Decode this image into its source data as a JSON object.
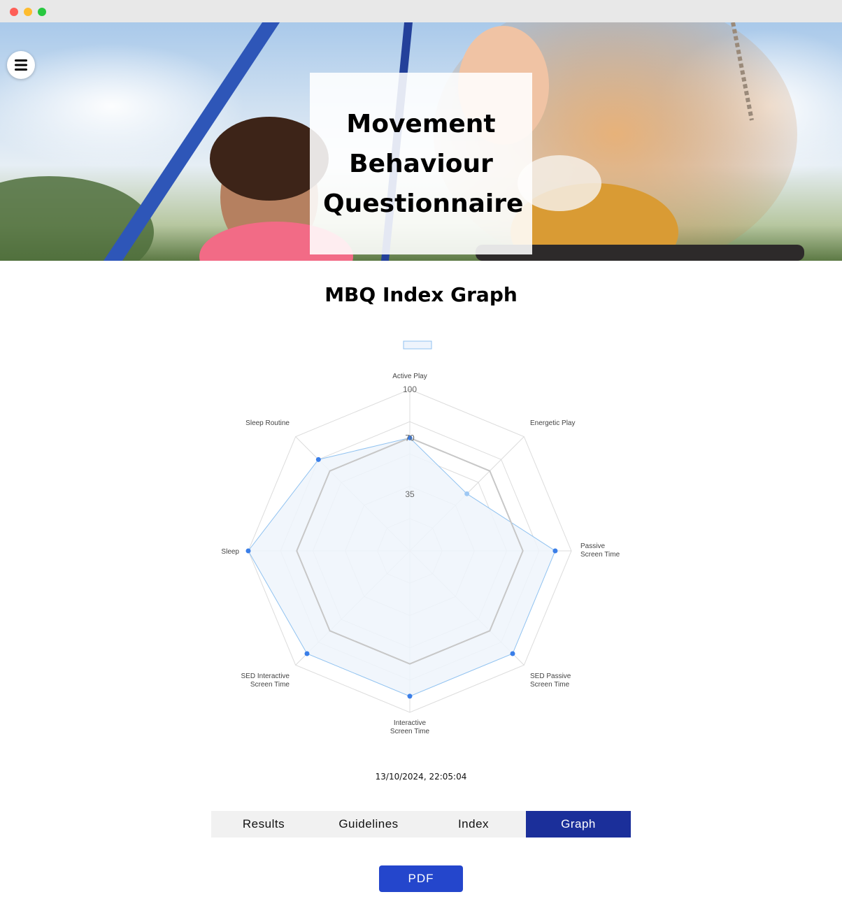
{
  "hero": {
    "title_line1": "Movement",
    "title_line2": "Behaviour",
    "title_line3": "Questionnaire"
  },
  "page": {
    "section_title": "MBQ Index Graph",
    "timestamp": "13/10/2024, 22:05:04"
  },
  "tabs": [
    {
      "label": "Results",
      "active": false
    },
    {
      "label": "Guidelines",
      "active": false
    },
    {
      "label": "Index",
      "active": false
    },
    {
      "label": "Graph",
      "active": true
    }
  ],
  "pdf_label": "PDF",
  "colors": {
    "series_fill": "#eef4fc",
    "series_line": "#90c2f0",
    "series_point": "#3a7ee8",
    "reference_line": "#c7c7c7",
    "grid": "#dcdcdc",
    "active_tab": "#1b2f9a",
    "pdf_button": "#2446cc"
  },
  "chart_data": {
    "type": "radar",
    "axes": [
      [
        "Active Play"
      ],
      [
        "Energetic Play"
      ],
      [
        "Passive",
        "Screen Time"
      ],
      [
        "SED Passive",
        "Screen Time"
      ],
      [
        "Interactive",
        "Screen Time"
      ],
      [
        "SED Interactive",
        "Screen Time"
      ],
      [
        "Sleep"
      ],
      [
        "Sleep Routine"
      ]
    ],
    "scale": {
      "min": 0,
      "max": 100
    },
    "tick_labels": [
      {
        "value": 35,
        "label": "35"
      },
      {
        "value": 70,
        "label": "70"
      },
      {
        "value": 100,
        "label": "100"
      }
    ],
    "series": [
      {
        "values": [
          70,
          50,
          90,
          90,
          90,
          90,
          100,
          80
        ]
      }
    ],
    "reference": {
      "values": [
        70,
        70,
        70,
        70,
        70,
        70,
        70,
        70
      ]
    },
    "legend": "top"
  }
}
